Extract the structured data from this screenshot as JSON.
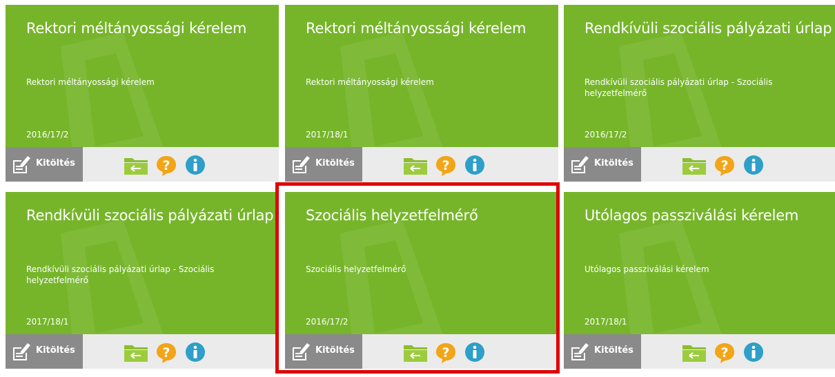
{
  "colors": {
    "card_green": "#76b52a",
    "bar_bg": "#ebebeb",
    "button_gray": "#8a8a8a",
    "help_orange": "#f2a516",
    "info_blue": "#2d9fc8",
    "folder_green": "#9ccc3e",
    "highlight_red": "#e00000"
  },
  "fill_label": "Kitöltés",
  "cards": [
    {
      "title": "Rektori méltányossági kérelem",
      "description": "Rektori méltányossági kérelem",
      "semester": "2016/17/2"
    },
    {
      "title": "Rektori méltányossági kérelem",
      "description": "Rektori méltányossági kérelem",
      "semester": "2017/18/1"
    },
    {
      "title": "Rendkívüli szociális pályázati úrlap",
      "description": "Rendkívüli szociális pályázati úrlap - Szociális helyzetfelmérő",
      "semester": "2016/17/2"
    },
    {
      "title": "Rendkívüli szociális pályázati úrlap",
      "description": "Rendkívüli szociális pályázati úrlap - Szociális helyzetfelmérő",
      "semester": "2017/18/1"
    },
    {
      "title": "Szociális helyzetfelmérő",
      "description": "Szociális helyzetfelmérő",
      "semester": "2016/17/2"
    },
    {
      "title": "Utólagos passziválási kérelem",
      "description": "Utólagos passziválási kérelem",
      "semester": "2017/18/1"
    }
  ],
  "icons": {
    "fill": "form-edit-icon",
    "folder": "folder-back-icon",
    "help": "question-icon",
    "info": "info-icon"
  }
}
